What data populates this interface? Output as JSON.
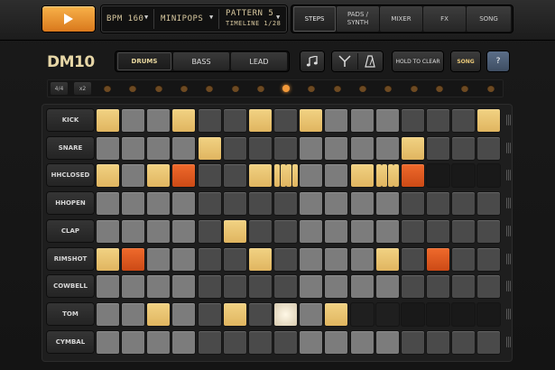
{
  "transport": {
    "play_icon": "play-icon"
  },
  "lcd": {
    "bpm": "BPM 160",
    "kit": "MINIPOPS",
    "pattern": "PATTERN 5",
    "timeline": "TIMELINE 1/28"
  },
  "tabs": [
    "STEPS",
    "PADS / SYNTH",
    "MIXER",
    "FX",
    "SONG"
  ],
  "logo": "DM10",
  "modes": [
    "DRUMS",
    "BASS",
    "LEAD"
  ],
  "toolbar": {
    "hold_label": "HOLD TO CLEAR",
    "song_label": "SONG",
    "help_label": "?",
    "icons": [
      "music-note-icon",
      "tuning-fork-icon",
      "metronome-icon"
    ]
  },
  "time_signature": [
    "4/4",
    "x2"
  ],
  "current_step": 8,
  "rows": [
    {
      "label": "KICK",
      "steps": [
        "on",
        "",
        "",
        "on",
        "",
        "",
        "on",
        "",
        "on",
        "",
        "",
        "",
        "",
        "",
        "",
        "on"
      ]
    },
    {
      "label": "SNARE",
      "steps": [
        "",
        "",
        "",
        "",
        "on",
        "",
        "",
        "",
        "",
        "",
        "",
        "",
        "on",
        "",
        "",
        ""
      ]
    },
    {
      "label": "HHCLOSED",
      "steps": [
        "on",
        "",
        "on",
        "accent",
        "",
        "",
        "on",
        "roll",
        "",
        "",
        "on",
        "roll",
        "accent",
        "dark",
        "dark",
        "dark"
      ]
    },
    {
      "label": "HHOPEN",
      "steps": [
        "",
        "",
        "",
        "",
        "",
        "",
        "",
        "",
        "",
        "",
        "",
        "",
        "",
        "",
        "",
        ""
      ]
    },
    {
      "label": "CLAP",
      "steps": [
        "",
        "",
        "",
        "",
        "",
        "on",
        "",
        "",
        "",
        "",
        "",
        "",
        "",
        "",
        "",
        ""
      ]
    },
    {
      "label": "RIMSHOT",
      "steps": [
        "on",
        "accent",
        "",
        "",
        "",
        "",
        "on",
        "",
        "",
        "",
        "",
        "on",
        "",
        "accent",
        "",
        ""
      ]
    },
    {
      "label": "COWBELL",
      "steps": [
        "",
        "",
        "",
        "",
        "",
        "",
        "",
        "",
        "",
        "",
        "",
        "",
        "",
        "",
        "",
        ""
      ]
    },
    {
      "label": "TOM",
      "steps": [
        "",
        "",
        "on",
        "",
        "",
        "on",
        "",
        "bright",
        "",
        "on",
        "dark",
        "dark",
        "dark",
        "dark",
        "dark",
        "dark"
      ]
    },
    {
      "label": "CYMBAL",
      "steps": [
        "",
        "",
        "",
        "",
        "",
        "",
        "",
        "",
        "",
        "",
        "",
        "",
        "",
        "",
        "",
        ""
      ]
    }
  ]
}
